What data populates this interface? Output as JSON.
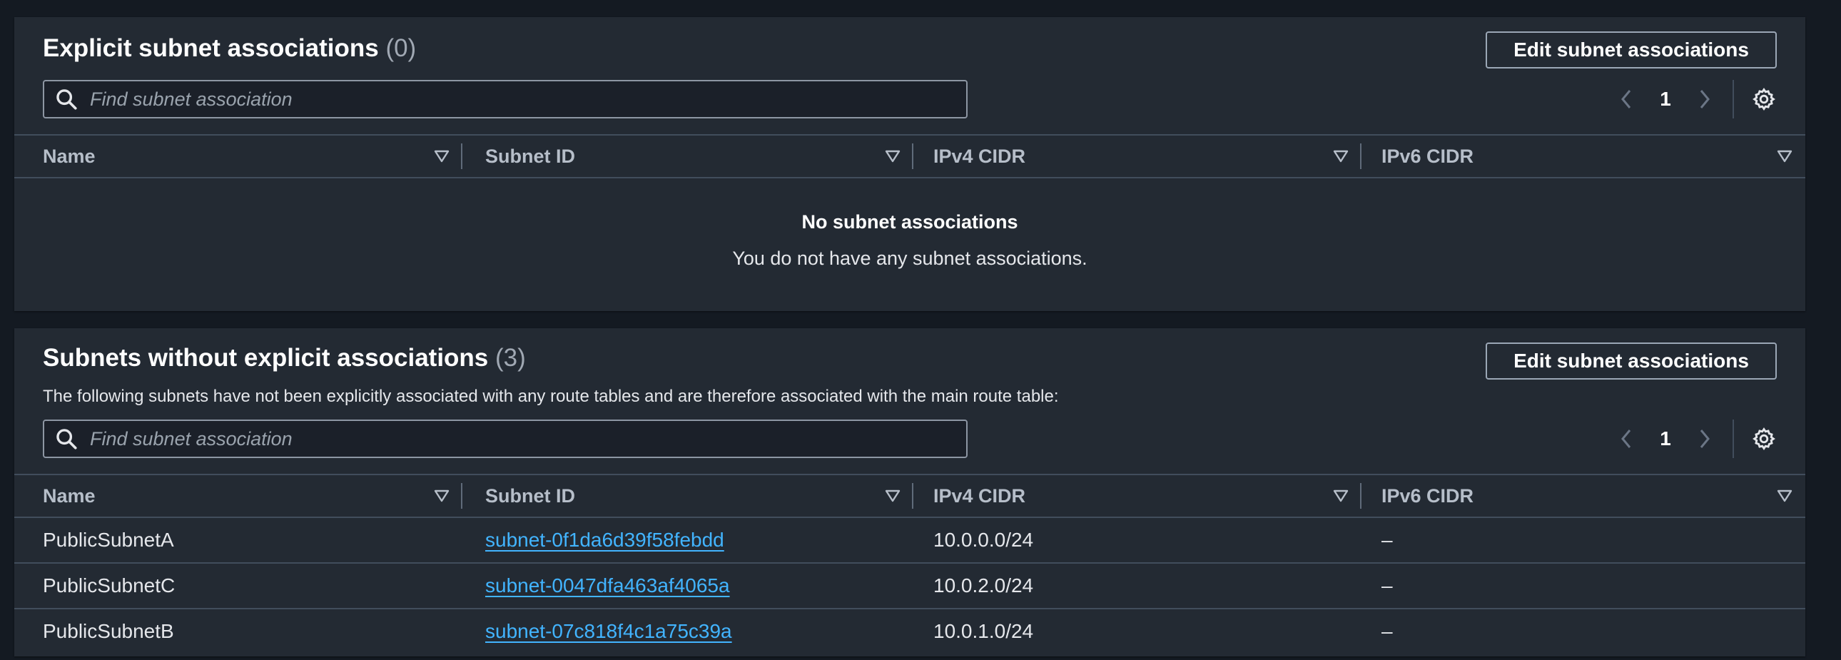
{
  "explicit": {
    "title": "Explicit subnet associations",
    "count": "(0)",
    "edit_label": "Edit subnet associations",
    "search_placeholder": "Find subnet association",
    "page": "1",
    "columns": [
      "Name",
      "Subnet ID",
      "IPv4 CIDR",
      "IPv6 CIDR"
    ],
    "empty_title": "No subnet associations",
    "empty_message": "You do not have any subnet associations."
  },
  "implicit": {
    "title": "Subnets without explicit associations",
    "count": "(3)",
    "description": "The following subnets have not been explicitly associated with any route tables and are therefore associated with the main route table:",
    "edit_label": "Edit subnet associations",
    "search_placeholder": "Find subnet association",
    "page": "1",
    "columns": [
      "Name",
      "Subnet ID",
      "IPv4 CIDR",
      "IPv6 CIDR"
    ],
    "rows": [
      {
        "name": "PublicSubnetA",
        "subnet_id": "subnet-0f1da6d39f58febdd",
        "ipv4": "10.0.0.0/24",
        "ipv6": "–"
      },
      {
        "name": "PublicSubnetC",
        "subnet_id": "subnet-0047dfa463af4065a",
        "ipv4": "10.0.2.0/24",
        "ipv6": "–"
      },
      {
        "name": "PublicSubnetB",
        "subnet_id": "subnet-07c818f4c1a75c39a",
        "ipv4": "10.0.1.0/24",
        "ipv6": "–"
      }
    ]
  },
  "colors": {
    "background": "#141a22",
    "panel": "#232a33",
    "link": "#42b4ff",
    "border": "#414d5c"
  },
  "icons": {
    "search": "search-icon",
    "prev": "chevron-left-icon",
    "next": "chevron-right-icon",
    "settings": "gear-icon",
    "sort": "sort-triangle-icon"
  }
}
